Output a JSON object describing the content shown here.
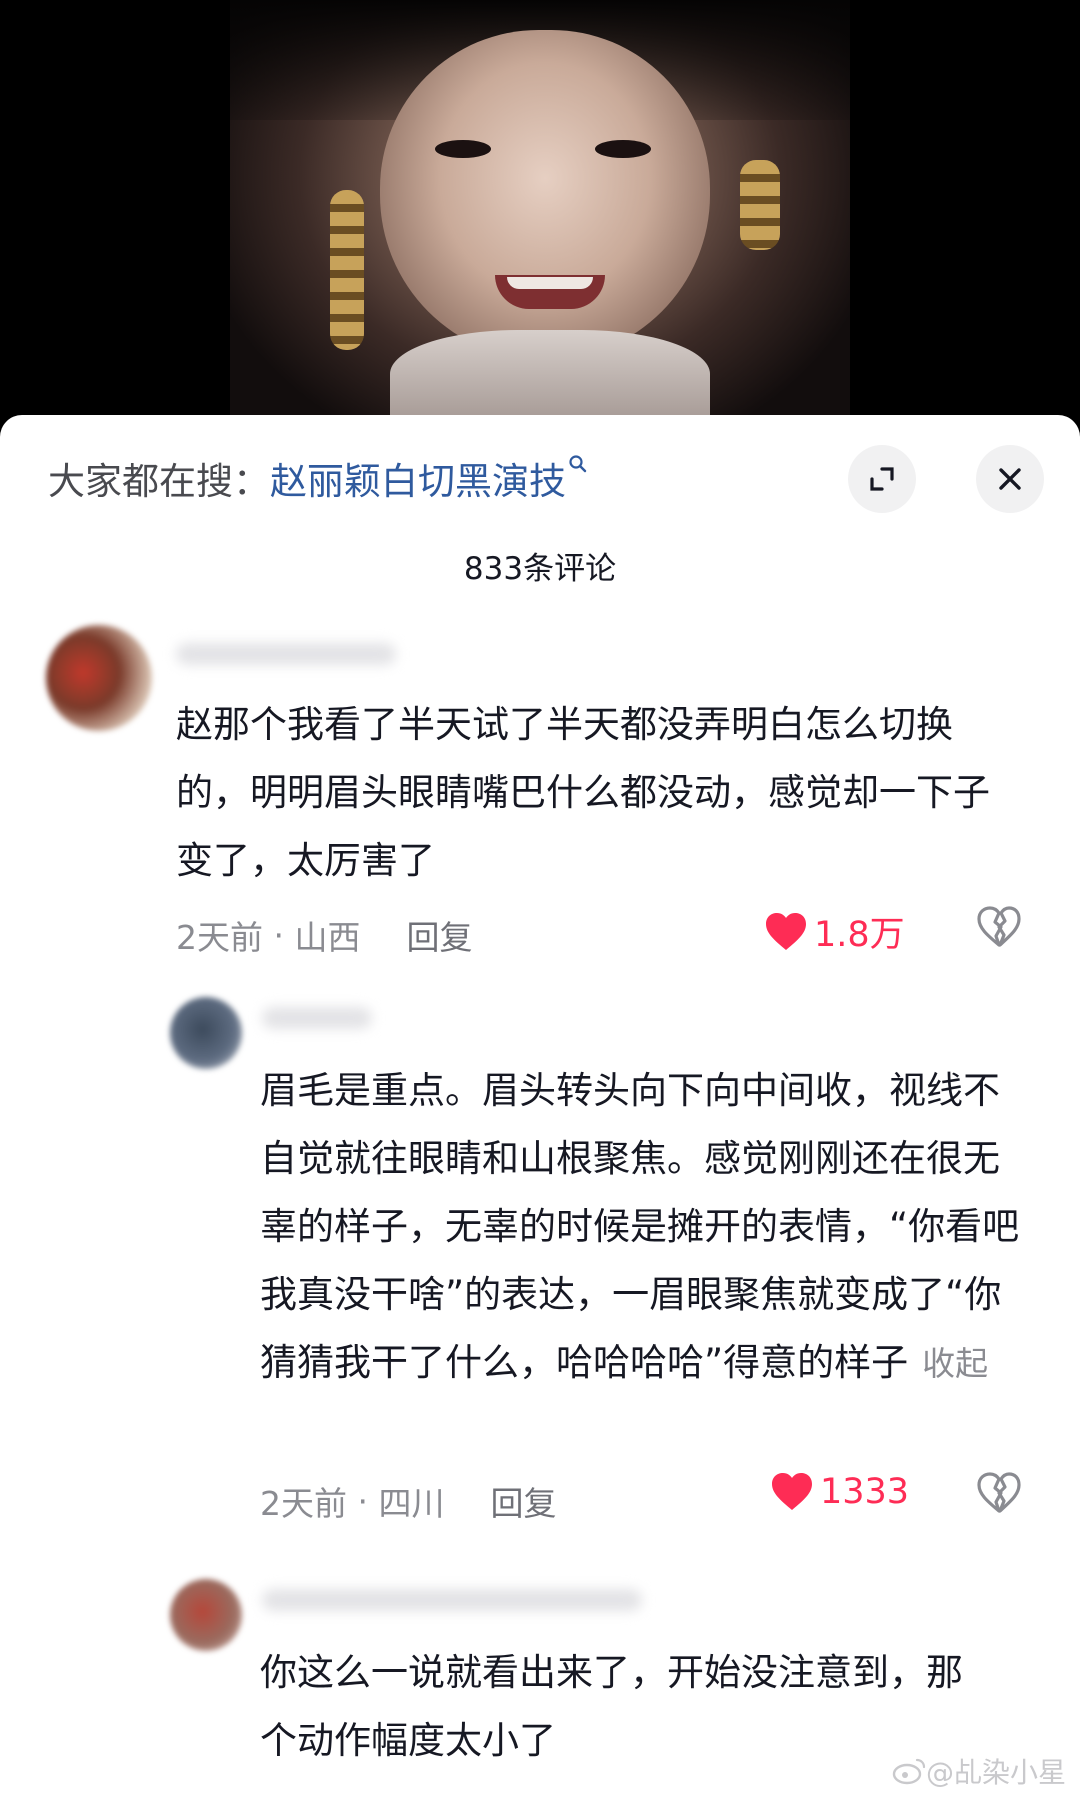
{
  "header": {
    "search_prefix": "大家都在搜：",
    "search_term": "赵丽颖白切黑演技",
    "comment_count": "833条评论"
  },
  "icons": {
    "search": "search-icon",
    "expand": "expand-icon",
    "close": "close-icon",
    "like": "heart-icon",
    "dislike": "broken-heart-icon"
  },
  "colors": {
    "like_red": "#fe2c55",
    "search_link": "#2f5a9e",
    "meta_gray": "#8a8b91"
  },
  "comments": [
    {
      "text": "赵那个我看了半天试了半天都没弄明白怎么切换的，明明眉头眼睛嘴巴什么都没动，感觉却一下子变了，太厉害了",
      "time": "2天前",
      "location": "山西",
      "reply": "回复",
      "likes": "1.8万"
    },
    {
      "text": "眉毛是重点。眉头转头向下向中间收，视线不自觉就往眼睛和山根聚焦。感觉刚刚还在很无辜的样子，无辜的时候是摊开的表情，“你看吧我真没干啥”的表达，一眉眼聚焦就变成了“你猜猜我干了什么，哈哈哈哈”得意的样子",
      "collapse": "收起",
      "time": "2天前",
      "location": "四川",
      "reply": "回复",
      "likes": "1333"
    },
    {
      "text": "你这么一说就看出来了，开始没注意到，那个动作幅度太小了"
    }
  ],
  "watermark": "@乩染小星"
}
